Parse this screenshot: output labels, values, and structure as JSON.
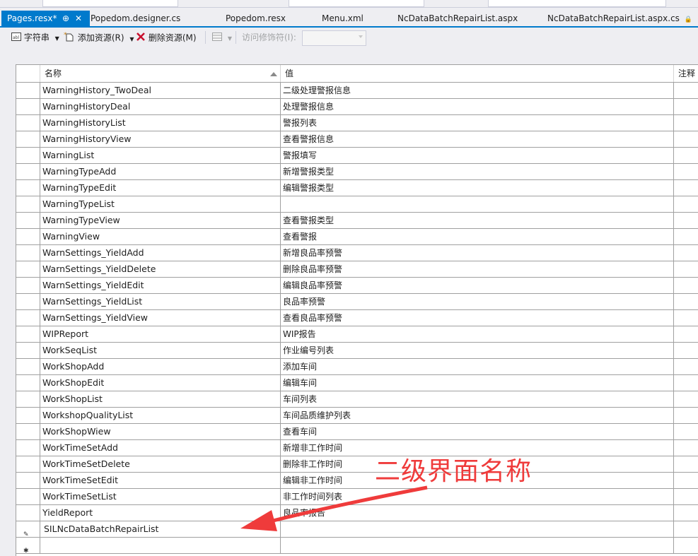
{
  "tabs": [
    {
      "label": "Pages.resx*",
      "active": true
    },
    {
      "label": "Popedom.designer.cs",
      "active": false
    },
    {
      "label": "Popedom.resx",
      "active": false
    },
    {
      "label": "Menu.xml",
      "active": false
    },
    {
      "label": "NcDataBatchRepairList.aspx",
      "active": false
    },
    {
      "label": "NcDataBatchRepairList.aspx.cs",
      "active": false
    }
  ],
  "toolbar": {
    "strings_label": "字符串",
    "add_resource_label": "添加资源(R)",
    "remove_resource_label": "删除资源(M)",
    "access_modifier_label": "访问修饰符(I):"
  },
  "grid": {
    "columns": [
      "名称",
      "值",
      "注释"
    ],
    "rows": [
      {
        "name": "WarningHistory_TwoDeal",
        "value": "二级处理警报信息"
      },
      {
        "name": "WarningHistoryDeal",
        "value": "处理警报信息"
      },
      {
        "name": "WarningHistoryList",
        "value": "警报列表"
      },
      {
        "name": "WarningHistoryView",
        "value": "查看警报信息"
      },
      {
        "name": "WarningList",
        "value": "警报填写"
      },
      {
        "name": "WarningTypeAdd",
        "value": "新增警报类型"
      },
      {
        "name": "WarningTypeEdit",
        "value": "编辑警报类型"
      },
      {
        "name": "WarningTypeList",
        "value": ""
      },
      {
        "name": "WarningTypeView",
        "value": "查看警报类型"
      },
      {
        "name": "WarningView",
        "value": "查看警报"
      },
      {
        "name": "WarnSettings_YieldAdd",
        "value": "新增良品率预警"
      },
      {
        "name": "WarnSettings_YieldDelete",
        "value": "删除良品率预警"
      },
      {
        "name": "WarnSettings_YieldEdit",
        "value": "编辑良品率预警"
      },
      {
        "name": "WarnSettings_YieldList",
        "value": "良品率预警"
      },
      {
        "name": "WarnSettings_YieldView",
        "value": "查看良品率预警"
      },
      {
        "name": "WIPReport",
        "value": "WIP报告"
      },
      {
        "name": "WorkSeqList",
        "value": "作业编号列表"
      },
      {
        "name": "WorkShopAdd",
        "value": "添加车间"
      },
      {
        "name": "WorkShopEdit",
        "value": "编辑车间"
      },
      {
        "name": "WorkShopList",
        "value": "车间列表"
      },
      {
        "name": "WorkshopQualityList",
        "value": "车间品质维护列表"
      },
      {
        "name": "WorkShopWiew",
        "value": "查看车间"
      },
      {
        "name": "WorkTimeSetAdd",
        "value": "新增非工作时间"
      },
      {
        "name": "WorkTimeSetDelete",
        "value": "删除非工作时间"
      },
      {
        "name": "WorkTimeSetEdit",
        "value": "编辑非工作时间"
      },
      {
        "name": "WorkTimeSetList",
        "value": "非工作时间列表"
      },
      {
        "name": "YieldReport",
        "value": "良品率报告"
      },
      {
        "name": "SILNcDataBatchRepairList",
        "value": "",
        "editing": true
      },
      {
        "name": "",
        "value": "",
        "new_row": true
      }
    ]
  },
  "annotation": {
    "text": "二级界面名称",
    "color": "#ef3b3b"
  },
  "colors": {
    "accent": "#007acc",
    "background": "#eeeef2"
  }
}
